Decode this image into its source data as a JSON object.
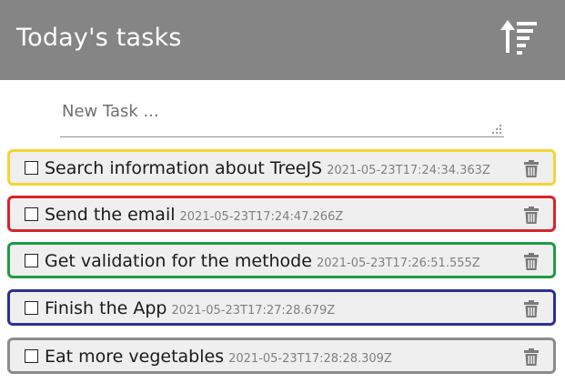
{
  "header": {
    "title": "Today's tasks",
    "sort_icon": "sort-amount-icon"
  },
  "new_task": {
    "placeholder": "New Task ...",
    "value": ""
  },
  "colors": {
    "header_bg": "#858585",
    "task_bg": "#efefef",
    "yellow": "#f2d535",
    "red": "#d9232d",
    "green": "#1f9b45",
    "blue": "#2e3191",
    "gray": "#8c8c8c"
  },
  "tasks": [
    {
      "title": "Search information about TreeJS",
      "date": "2021-05-23T17:24:34.363Z",
      "color": "#f2d535",
      "done": false
    },
    {
      "title": "Send the email",
      "date": "2021-05-23T17:24:47.266Z",
      "color": "#d9232d",
      "done": false
    },
    {
      "title": "Get validation for the methode",
      "date": "2021-05-23T17:26:51.555Z",
      "color": "#1f9b45",
      "done": false
    },
    {
      "title": "Finish the App",
      "date": "2021-05-23T17:27:28.679Z",
      "color": "#2e3191",
      "done": false
    },
    {
      "title": "Eat more vegetables",
      "date": "2021-05-23T17:28:28.309Z",
      "color": "#8c8c8c",
      "done": false
    }
  ]
}
